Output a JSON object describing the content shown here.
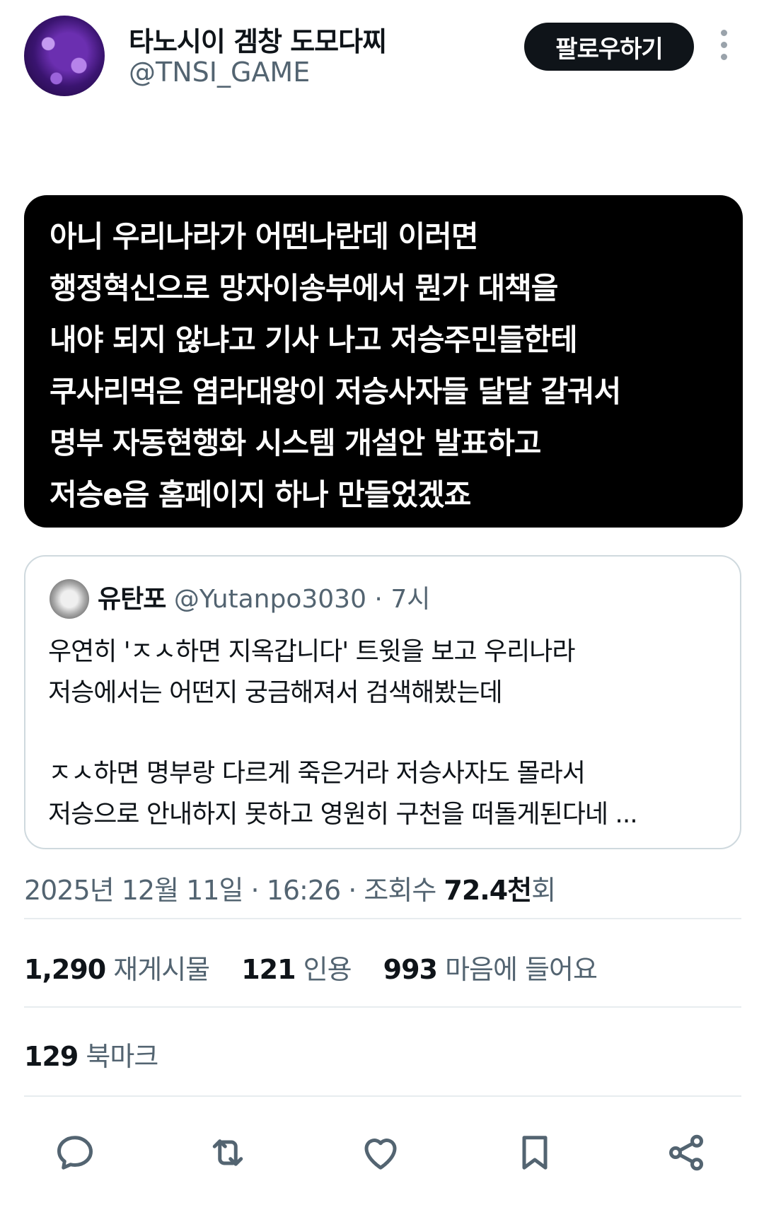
{
  "author": {
    "display_name": "타노시이 겜창 도모다찌",
    "handle": "@TNSI_GAME",
    "follow_label": "팔로우하기"
  },
  "image_text": [
    "아니 우리나라가 어떤나란데 이러면",
    "행정혁신으로 망자이송부에서 뭔가 대책을",
    "내야 되지 않냐고 기사 나고 저승주민들한테",
    "쿠사리먹은 염라대왕이 저승사자들 달달 갈궈서",
    "명부 자동현행화 시스템 개설안 발표하고",
    "저승e음 홈페이지 하나 만들었겠죠"
  ],
  "quote": {
    "name": "유탄포",
    "meta": "@Yutanpo3030 · 7시",
    "lines": [
      "우연히 'ㅈㅅ하면 지옥갑니다' 트윗을 보고 우리나라",
      "저승에서는 어떤지 궁금해져서 검색해봤는데",
      "ㅈㅅ하면 명부랑 다르게 죽은거라 저승사자도 몰라서",
      "저승으로 안내하지 못하고 영원히 구천을 떠돌게된다네 ..."
    ]
  },
  "meta": {
    "date": "2025년 12월 11일 · 16:26 · 조회수 ",
    "views_number": "72.4천",
    "views_suffix": "회"
  },
  "stats": {
    "reposts_count": "1,290",
    "reposts_label": "재게시물",
    "quotes_count": "121",
    "quotes_label": "인용",
    "likes_count": "993",
    "likes_label": "마음에 들어요",
    "bookmarks_count": "129",
    "bookmarks_label": "북마크"
  },
  "actions": [
    "reply-icon",
    "repost-icon",
    "like-icon",
    "bookmark-icon",
    "share-icon"
  ],
  "colors": {
    "primary_text": "#0f1419",
    "secondary_text": "#536471",
    "border": "#cfd9de"
  }
}
